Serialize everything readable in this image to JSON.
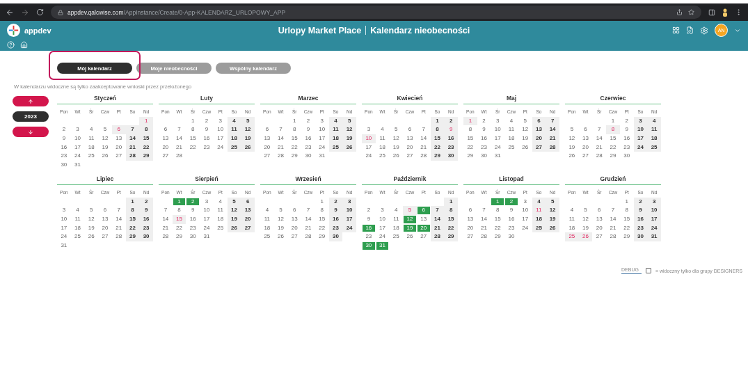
{
  "browser": {
    "url_host": "appdev.qalcwise.com",
    "url_path": "/AppInstance/Create/0-App-KALENDARZ_URLOPOWY_APP"
  },
  "header": {
    "app_name": "appdev",
    "title": "Urlopy Market Place",
    "subtitle": "Kalendarz nieobecności",
    "avatar": "AN"
  },
  "tabs": [
    {
      "label": "Mój kalendarz",
      "selected": true
    },
    {
      "label": "Moje nieobecności",
      "selected": false
    },
    {
      "label": "Wspólny kalendarz",
      "selected": false
    }
  ],
  "notice": "W kalendarzu widoczne są tylko zaakceptowane wnioski przez przełożonego",
  "year": "2023",
  "months": [
    {
      "name": "Styczeń",
      "weekdays": [
        "Pon",
        "Wt",
        "Śr",
        "Czw",
        "Pt",
        "So",
        "Nd"
      ],
      "weeks": [
        [
          {
            "kind": "blank"
          },
          {
            "kind": "blank"
          },
          {
            "kind": "blank"
          },
          {
            "kind": "blank"
          },
          {
            "kind": "blank"
          },
          {
            "kind": "blank"
          },
          {
            "day": "1",
            "kind": "holiday"
          }
        ],
        [
          {
            "day": "2",
            "kind": "workday"
          },
          {
            "day": "3",
            "kind": "workday"
          },
          {
            "day": "4",
            "kind": "workday"
          },
          {
            "day": "5",
            "kind": "workday"
          },
          {
            "day": "6",
            "kind": "holiday"
          },
          {
            "day": "7",
            "kind": "weekend"
          },
          {
            "day": "8",
            "kind": "weekend"
          }
        ],
        [
          {
            "day": "9",
            "kind": "workday"
          },
          {
            "day": "10",
            "kind": "workday"
          },
          {
            "day": "11",
            "kind": "workday"
          },
          {
            "day": "12",
            "kind": "workday"
          },
          {
            "day": "13",
            "kind": "workday"
          },
          {
            "day": "14",
            "kind": "weekend"
          },
          {
            "day": "15",
            "kind": "weekend"
          }
        ],
        [
          {
            "day": "16",
            "kind": "workday"
          },
          {
            "day": "17",
            "kind": "workday"
          },
          {
            "day": "18",
            "kind": "workday"
          },
          {
            "day": "19",
            "kind": "workday"
          },
          {
            "day": "20",
            "kind": "workday"
          },
          {
            "day": "21",
            "kind": "weekend"
          },
          {
            "day": "22",
            "kind": "weekend"
          }
        ],
        [
          {
            "day": "23",
            "kind": "workday"
          },
          {
            "day": "24",
            "kind": "workday"
          },
          {
            "day": "25",
            "kind": "workday"
          },
          {
            "day": "26",
            "kind": "workday"
          },
          {
            "day": "27",
            "kind": "workday"
          },
          {
            "day": "28",
            "kind": "weekend"
          },
          {
            "day": "29",
            "kind": "weekend"
          }
        ],
        [
          {
            "day": "30",
            "kind": "workday"
          },
          {
            "day": "31",
            "kind": "workday"
          }
        ]
      ]
    },
    {
      "name": "Luty",
      "weekdays": [
        "Pon",
        "Wt",
        "Śr",
        "Czw",
        "Pt",
        "So",
        "Nd"
      ],
      "weeks": [
        [
          {
            "kind": "blank"
          },
          {
            "kind": "blank"
          },
          {
            "day": "1",
            "kind": "workday"
          },
          {
            "day": "2",
            "kind": "workday"
          },
          {
            "day": "3",
            "kind": "workday"
          },
          {
            "day": "4",
            "kind": "weekend"
          },
          {
            "day": "5",
            "kind": "weekend"
          }
        ],
        [
          {
            "day": "6",
            "kind": "workday"
          },
          {
            "day": "7",
            "kind": "workday"
          },
          {
            "day": "8",
            "kind": "workday"
          },
          {
            "day": "9",
            "kind": "workday"
          },
          {
            "day": "10",
            "kind": "workday"
          },
          {
            "day": "11",
            "kind": "weekend"
          },
          {
            "day": "12",
            "kind": "weekend"
          }
        ],
        [
          {
            "day": "13",
            "kind": "workday"
          },
          {
            "day": "14",
            "kind": "workday"
          },
          {
            "day": "15",
            "kind": "workday"
          },
          {
            "day": "16",
            "kind": "workday"
          },
          {
            "day": "17",
            "kind": "workday"
          },
          {
            "day": "18",
            "kind": "weekend"
          },
          {
            "day": "19",
            "kind": "weekend"
          }
        ],
        [
          {
            "day": "20",
            "kind": "workday"
          },
          {
            "day": "21",
            "kind": "workday"
          },
          {
            "day": "22",
            "kind": "workday"
          },
          {
            "day": "23",
            "kind": "workday"
          },
          {
            "day": "24",
            "kind": "workday"
          },
          {
            "day": "25",
            "kind": "weekend"
          },
          {
            "day": "26",
            "kind": "weekend"
          }
        ],
        [
          {
            "day": "27",
            "kind": "workday"
          },
          {
            "day": "28",
            "kind": "workday"
          }
        ]
      ]
    },
    {
      "name": "Marzec",
      "weekdays": [
        "Pon",
        "Wt",
        "Śr",
        "Czw",
        "Pt",
        "So",
        "Nd"
      ],
      "weeks": [
        [
          {
            "kind": "blank"
          },
          {
            "kind": "blank"
          },
          {
            "day": "1",
            "kind": "workday"
          },
          {
            "day": "2",
            "kind": "workday"
          },
          {
            "day": "3",
            "kind": "workday"
          },
          {
            "day": "4",
            "kind": "weekend"
          },
          {
            "day": "5",
            "kind": "weekend"
          }
        ],
        [
          {
            "day": "6",
            "kind": "workday"
          },
          {
            "day": "7",
            "kind": "workday"
          },
          {
            "day": "8",
            "kind": "workday"
          },
          {
            "day": "9",
            "kind": "workday"
          },
          {
            "day": "10",
            "kind": "workday"
          },
          {
            "day": "11",
            "kind": "weekend"
          },
          {
            "day": "12",
            "kind": "weekend"
          }
        ],
        [
          {
            "day": "13",
            "kind": "workday"
          },
          {
            "day": "14",
            "kind": "workday"
          },
          {
            "day": "15",
            "kind": "workday"
          },
          {
            "day": "16",
            "kind": "workday"
          },
          {
            "day": "17",
            "kind": "workday"
          },
          {
            "day": "18",
            "kind": "weekend"
          },
          {
            "day": "19",
            "kind": "weekend"
          }
        ],
        [
          {
            "day": "20",
            "kind": "workday"
          },
          {
            "day": "21",
            "kind": "workday"
          },
          {
            "day": "22",
            "kind": "workday"
          },
          {
            "day": "23",
            "kind": "workday"
          },
          {
            "day": "24",
            "kind": "workday"
          },
          {
            "day": "25",
            "kind": "weekend"
          },
          {
            "day": "26",
            "kind": "weekend"
          }
        ],
        [
          {
            "day": "27",
            "kind": "workday"
          },
          {
            "day": "28",
            "kind": "workday"
          },
          {
            "day": "29",
            "kind": "workday"
          },
          {
            "day": "30",
            "kind": "workday"
          },
          {
            "day": "31",
            "kind": "workday"
          }
        ]
      ]
    },
    {
      "name": "Kwiecień",
      "weekdays": [
        "Pon",
        "Wt",
        "Śr",
        "Czw",
        "Pt",
        "So",
        "Nd"
      ],
      "weeks": [
        [
          {
            "kind": "blank"
          },
          {
            "kind": "blank"
          },
          {
            "kind": "blank"
          },
          {
            "kind": "blank"
          },
          {
            "kind": "blank"
          },
          {
            "day": "1",
            "kind": "weekend"
          },
          {
            "day": "2",
            "kind": "weekend"
          }
        ],
        [
          {
            "day": "3",
            "kind": "workday"
          },
          {
            "day": "4",
            "kind": "workday"
          },
          {
            "day": "5",
            "kind": "workday"
          },
          {
            "day": "6",
            "kind": "workday"
          },
          {
            "day": "7",
            "kind": "workday"
          },
          {
            "day": "8",
            "kind": "weekend"
          },
          {
            "day": "9",
            "kind": "holiday"
          }
        ],
        [
          {
            "day": "10",
            "kind": "holiday"
          },
          {
            "day": "11",
            "kind": "workday"
          },
          {
            "day": "12",
            "kind": "workday"
          },
          {
            "day": "13",
            "kind": "workday"
          },
          {
            "day": "14",
            "kind": "workday"
          },
          {
            "day": "15",
            "kind": "weekend"
          },
          {
            "day": "16",
            "kind": "weekend"
          }
        ],
        [
          {
            "day": "17",
            "kind": "workday"
          },
          {
            "day": "18",
            "kind": "workday"
          },
          {
            "day": "19",
            "kind": "workday"
          },
          {
            "day": "20",
            "kind": "workday"
          },
          {
            "day": "21",
            "kind": "workday"
          },
          {
            "day": "22",
            "kind": "weekend"
          },
          {
            "day": "23",
            "kind": "weekend"
          }
        ],
        [
          {
            "day": "24",
            "kind": "workday"
          },
          {
            "day": "25",
            "kind": "workday"
          },
          {
            "day": "26",
            "kind": "workday"
          },
          {
            "day": "27",
            "kind": "workday"
          },
          {
            "day": "28",
            "kind": "workday"
          },
          {
            "day": "29",
            "kind": "weekend"
          },
          {
            "day": "30",
            "kind": "weekend"
          }
        ]
      ]
    },
    {
      "name": "Maj",
      "weekdays": [
        "Pon",
        "Wt",
        "Śr",
        "Czw",
        "Pt",
        "So",
        "Nd"
      ],
      "weeks": [
        [
          {
            "day": "1",
            "kind": "holiday"
          },
          {
            "day": "2",
            "kind": "workday"
          },
          {
            "day": "3",
            "kind": "workday"
          },
          {
            "day": "4",
            "kind": "workday"
          },
          {
            "day": "5",
            "kind": "workday"
          },
          {
            "day": "6",
            "kind": "weekend"
          },
          {
            "day": "7",
            "kind": "weekend"
          }
        ],
        [
          {
            "day": "8",
            "kind": "workday"
          },
          {
            "day": "9",
            "kind": "workday"
          },
          {
            "day": "10",
            "kind": "workday"
          },
          {
            "day": "11",
            "kind": "workday"
          },
          {
            "day": "12",
            "kind": "workday"
          },
          {
            "day": "13",
            "kind": "weekend"
          },
          {
            "day": "14",
            "kind": "weekend"
          }
        ],
        [
          {
            "day": "15",
            "kind": "workday"
          },
          {
            "day": "16",
            "kind": "workday"
          },
          {
            "day": "17",
            "kind": "workday"
          },
          {
            "day": "18",
            "kind": "workday"
          },
          {
            "day": "19",
            "kind": "workday"
          },
          {
            "day": "20",
            "kind": "weekend"
          },
          {
            "day": "21",
            "kind": "weekend"
          }
        ],
        [
          {
            "day": "22",
            "kind": "workday"
          },
          {
            "day": "23",
            "kind": "workday"
          },
          {
            "day": "24",
            "kind": "workday"
          },
          {
            "day": "25",
            "kind": "workday"
          },
          {
            "day": "26",
            "kind": "workday"
          },
          {
            "day": "27",
            "kind": "weekend"
          },
          {
            "day": "28",
            "kind": "weekend"
          }
        ],
        [
          {
            "day": "29",
            "kind": "workday"
          },
          {
            "day": "30",
            "kind": "workday"
          },
          {
            "day": "31",
            "kind": "workday"
          }
        ]
      ]
    },
    {
      "name": "Czerwiec",
      "weekdays": [
        "Pon",
        "Wt",
        "Śr",
        "Czw",
        "Pt",
        "So",
        "Nd"
      ],
      "weeks": [
        [
          {
            "kind": "blank"
          },
          {
            "kind": "blank"
          },
          {
            "kind": "blank"
          },
          {
            "day": "1",
            "kind": "workday"
          },
          {
            "day": "2",
            "kind": "workday"
          },
          {
            "day": "3",
            "kind": "weekend"
          },
          {
            "day": "4",
            "kind": "weekend"
          }
        ],
        [
          {
            "day": "5",
            "kind": "workday"
          },
          {
            "day": "6",
            "kind": "workday"
          },
          {
            "day": "7",
            "kind": "workday"
          },
          {
            "day": "8",
            "kind": "holiday"
          },
          {
            "day": "9",
            "kind": "workday"
          },
          {
            "day": "10",
            "kind": "weekend"
          },
          {
            "day": "11",
            "kind": "weekend"
          }
        ],
        [
          {
            "day": "12",
            "kind": "workday"
          },
          {
            "day": "13",
            "kind": "workday"
          },
          {
            "day": "14",
            "kind": "workday"
          },
          {
            "day": "15",
            "kind": "workday"
          },
          {
            "day": "16",
            "kind": "workday"
          },
          {
            "day": "17",
            "kind": "weekend"
          },
          {
            "day": "18",
            "kind": "weekend"
          }
        ],
        [
          {
            "day": "19",
            "kind": "workday"
          },
          {
            "day": "20",
            "kind": "workday"
          },
          {
            "day": "21",
            "kind": "workday"
          },
          {
            "day": "22",
            "kind": "workday"
          },
          {
            "day": "23",
            "kind": "workday"
          },
          {
            "day": "24",
            "kind": "weekend"
          },
          {
            "day": "25",
            "kind": "weekend"
          }
        ],
        [
          {
            "day": "26",
            "kind": "workday"
          },
          {
            "day": "27",
            "kind": "workday"
          },
          {
            "day": "28",
            "kind": "workday"
          },
          {
            "day": "29",
            "kind": "workday"
          },
          {
            "day": "30",
            "kind": "workday"
          }
        ]
      ]
    },
    {
      "name": "Lipiec",
      "weekdays": [
        "Pon",
        "Wt",
        "Śr",
        "Czw",
        "Pt",
        "So",
        "Nd"
      ],
      "weeks": [
        [
          {
            "kind": "blank"
          },
          {
            "kind": "blank"
          },
          {
            "kind": "blank"
          },
          {
            "kind": "blank"
          },
          {
            "kind": "blank"
          },
          {
            "day": "1",
            "kind": "weekend"
          },
          {
            "day": "2",
            "kind": "weekend"
          }
        ],
        [
          {
            "day": "3",
            "kind": "workday"
          },
          {
            "day": "4",
            "kind": "workday"
          },
          {
            "day": "5",
            "kind": "workday"
          },
          {
            "day": "6",
            "kind": "workday"
          },
          {
            "day": "7",
            "kind": "workday"
          },
          {
            "day": "8",
            "kind": "weekend"
          },
          {
            "day": "9",
            "kind": "weekend"
          }
        ],
        [
          {
            "day": "10",
            "kind": "workday"
          },
          {
            "day": "11",
            "kind": "workday"
          },
          {
            "day": "12",
            "kind": "workday"
          },
          {
            "day": "13",
            "kind": "workday"
          },
          {
            "day": "14",
            "kind": "workday"
          },
          {
            "day": "15",
            "kind": "weekend"
          },
          {
            "day": "16",
            "kind": "weekend"
          }
        ],
        [
          {
            "day": "17",
            "kind": "workday"
          },
          {
            "day": "18",
            "kind": "workday"
          },
          {
            "day": "19",
            "kind": "workday"
          },
          {
            "day": "20",
            "kind": "workday"
          },
          {
            "day": "21",
            "kind": "workday"
          },
          {
            "day": "22",
            "kind": "weekend"
          },
          {
            "day": "23",
            "kind": "weekend"
          }
        ],
        [
          {
            "day": "24",
            "kind": "workday"
          },
          {
            "day": "25",
            "kind": "workday"
          },
          {
            "day": "26",
            "kind": "workday"
          },
          {
            "day": "27",
            "kind": "workday"
          },
          {
            "day": "28",
            "kind": "workday"
          },
          {
            "day": "29",
            "kind": "weekend"
          },
          {
            "day": "30",
            "kind": "weekend"
          }
        ],
        [
          {
            "day": "31",
            "kind": "workday"
          }
        ]
      ]
    },
    {
      "name": "Sierpień",
      "weekdays": [
        "Pon",
        "Wt",
        "Śr",
        "Czw",
        "Pt",
        "So",
        "Nd"
      ],
      "weeks": [
        [
          {
            "kind": "blank"
          },
          {
            "day": "1",
            "kind": "leave"
          },
          {
            "day": "2",
            "kind": "leave"
          },
          {
            "day": "3",
            "kind": "workday"
          },
          {
            "day": "4",
            "kind": "workday"
          },
          {
            "day": "5",
            "kind": "weekend"
          },
          {
            "day": "6",
            "kind": "weekend"
          }
        ],
        [
          {
            "day": "7",
            "kind": "workday"
          },
          {
            "day": "8",
            "kind": "workday"
          },
          {
            "day": "9",
            "kind": "workday"
          },
          {
            "day": "10",
            "kind": "workday"
          },
          {
            "day": "11",
            "kind": "workday"
          },
          {
            "day": "12",
            "kind": "weekend"
          },
          {
            "day": "13",
            "kind": "weekend"
          }
        ],
        [
          {
            "day": "14",
            "kind": "workday"
          },
          {
            "day": "15",
            "kind": "holiday"
          },
          {
            "day": "16",
            "kind": "workday"
          },
          {
            "day": "17",
            "kind": "workday"
          },
          {
            "day": "18",
            "kind": "workday"
          },
          {
            "day": "19",
            "kind": "weekend"
          },
          {
            "day": "20",
            "kind": "weekend"
          }
        ],
        [
          {
            "day": "21",
            "kind": "workday"
          },
          {
            "day": "22",
            "kind": "workday"
          },
          {
            "day": "23",
            "kind": "workday"
          },
          {
            "day": "24",
            "kind": "workday"
          },
          {
            "day": "25",
            "kind": "workday"
          },
          {
            "day": "26",
            "kind": "weekend"
          },
          {
            "day": "27",
            "kind": "weekend"
          }
        ],
        [
          {
            "day": "28",
            "kind": "workday"
          },
          {
            "day": "29",
            "kind": "workday"
          },
          {
            "day": "30",
            "kind": "workday"
          },
          {
            "day": "31",
            "kind": "workday"
          }
        ]
      ]
    },
    {
      "name": "Wrzesień",
      "weekdays": [
        "Pon",
        "Wt",
        "Śr",
        "Czw",
        "Pt",
        "So",
        "Nd"
      ],
      "weeks": [
        [
          {
            "kind": "blank"
          },
          {
            "kind": "blank"
          },
          {
            "kind": "blank"
          },
          {
            "kind": "blank"
          },
          {
            "day": "1",
            "kind": "workday"
          },
          {
            "day": "2",
            "kind": "weekend"
          },
          {
            "day": "3",
            "kind": "weekend"
          }
        ],
        [
          {
            "day": "4",
            "kind": "workday"
          },
          {
            "day": "5",
            "kind": "workday"
          },
          {
            "day": "6",
            "kind": "workday"
          },
          {
            "day": "7",
            "kind": "workday"
          },
          {
            "day": "8",
            "kind": "workday"
          },
          {
            "day": "9",
            "kind": "weekend"
          },
          {
            "day": "10",
            "kind": "weekend"
          }
        ],
        [
          {
            "day": "11",
            "kind": "workday"
          },
          {
            "day": "12",
            "kind": "workday"
          },
          {
            "day": "13",
            "kind": "workday"
          },
          {
            "day": "14",
            "kind": "workday"
          },
          {
            "day": "15",
            "kind": "workday"
          },
          {
            "day": "16",
            "kind": "weekend"
          },
          {
            "day": "17",
            "kind": "weekend"
          }
        ],
        [
          {
            "day": "18",
            "kind": "workday"
          },
          {
            "day": "19",
            "kind": "workday"
          },
          {
            "day": "20",
            "kind": "workday"
          },
          {
            "day": "21",
            "kind": "workday"
          },
          {
            "day": "22",
            "kind": "workday"
          },
          {
            "day": "23",
            "kind": "weekend"
          },
          {
            "day": "24",
            "kind": "weekend"
          }
        ],
        [
          {
            "day": "25",
            "kind": "workday"
          },
          {
            "day": "26",
            "kind": "workday"
          },
          {
            "day": "27",
            "kind": "workday"
          },
          {
            "day": "28",
            "kind": "workday"
          },
          {
            "day": "29",
            "kind": "workday"
          },
          {
            "day": "30",
            "kind": "weekend"
          }
        ]
      ]
    },
    {
      "name": "Październik",
      "weekdays": [
        "Pon",
        "Wt",
        "Śr",
        "Czw",
        "Pt",
        "So",
        "Nd"
      ],
      "weeks": [
        [
          {
            "kind": "blank"
          },
          {
            "kind": "blank"
          },
          {
            "kind": "blank"
          },
          {
            "kind": "blank"
          },
          {
            "kind": "blank"
          },
          {
            "kind": "blank"
          },
          {
            "day": "1",
            "kind": "weekend"
          }
        ],
        [
          {
            "day": "2",
            "kind": "workday"
          },
          {
            "day": "3",
            "kind": "workday"
          },
          {
            "day": "4",
            "kind": "workday"
          },
          {
            "day": "5",
            "kind": "holiday"
          },
          {
            "day": "6",
            "kind": "leave"
          },
          {
            "day": "7",
            "kind": "weekend"
          },
          {
            "day": "8",
            "kind": "weekend"
          }
        ],
        [
          {
            "day": "9",
            "kind": "workday"
          },
          {
            "day": "10",
            "kind": "workday"
          },
          {
            "day": "11",
            "kind": "workday"
          },
          {
            "day": "12",
            "kind": "leave"
          },
          {
            "day": "13",
            "kind": "workday"
          },
          {
            "day": "14",
            "kind": "weekend"
          },
          {
            "day": "15",
            "kind": "weekend"
          }
        ],
        [
          {
            "day": "16",
            "kind": "leave"
          },
          {
            "day": "17",
            "kind": "workday"
          },
          {
            "day": "18",
            "kind": "workday"
          },
          {
            "day": "19",
            "kind": "leave"
          },
          {
            "day": "20",
            "kind": "leave"
          },
          {
            "day": "21",
            "kind": "weekend"
          },
          {
            "day": "22",
            "kind": "weekend"
          }
        ],
        [
          {
            "day": "23",
            "kind": "workday"
          },
          {
            "day": "24",
            "kind": "workday"
          },
          {
            "day": "25",
            "kind": "workday"
          },
          {
            "day": "26",
            "kind": "workday"
          },
          {
            "day": "27",
            "kind": "workday"
          },
          {
            "day": "28",
            "kind": "weekend"
          },
          {
            "day": "29",
            "kind": "weekend"
          }
        ],
        [
          {
            "day": "30",
            "kind": "leave"
          },
          {
            "day": "31",
            "kind": "leave"
          }
        ]
      ]
    },
    {
      "name": "Listopad",
      "weekdays": [
        "Pon",
        "Wt",
        "Śr",
        "Czw",
        "Pt",
        "So",
        "Nd"
      ],
      "weeks": [
        [
          {
            "kind": "blank"
          },
          {
            "kind": "blank"
          },
          {
            "day": "1",
            "kind": "leave"
          },
          {
            "day": "2",
            "kind": "leave"
          },
          {
            "day": "3",
            "kind": "workday"
          },
          {
            "day": "4",
            "kind": "weekend"
          },
          {
            "day": "5",
            "kind": "weekend"
          }
        ],
        [
          {
            "day": "6",
            "kind": "workday"
          },
          {
            "day": "7",
            "kind": "workday"
          },
          {
            "day": "8",
            "kind": "workday"
          },
          {
            "day": "9",
            "kind": "workday"
          },
          {
            "day": "10",
            "kind": "workday"
          },
          {
            "day": "11",
            "kind": "holiday"
          },
          {
            "day": "12",
            "kind": "weekend"
          }
        ],
        [
          {
            "day": "13",
            "kind": "workday"
          },
          {
            "day": "14",
            "kind": "workday"
          },
          {
            "day": "15",
            "kind": "workday"
          },
          {
            "day": "16",
            "kind": "workday"
          },
          {
            "day": "17",
            "kind": "workday"
          },
          {
            "day": "18",
            "kind": "weekend"
          },
          {
            "day": "19",
            "kind": "weekend"
          }
        ],
        [
          {
            "day": "20",
            "kind": "workday"
          },
          {
            "day": "21",
            "kind": "workday"
          },
          {
            "day": "22",
            "kind": "workday"
          },
          {
            "day": "23",
            "kind": "workday"
          },
          {
            "day": "24",
            "kind": "workday"
          },
          {
            "day": "25",
            "kind": "weekend"
          },
          {
            "day": "26",
            "kind": "weekend"
          }
        ],
        [
          {
            "day": "27",
            "kind": "workday"
          },
          {
            "day": "28",
            "kind": "workday"
          },
          {
            "day": "29",
            "kind": "workday"
          },
          {
            "day": "30",
            "kind": "workday"
          }
        ]
      ]
    },
    {
      "name": "Grudzień",
      "weekdays": [
        "Pon",
        "Wt",
        "Śr",
        "Czw",
        "Pt",
        "So",
        "Nd"
      ],
      "weeks": [
        [
          {
            "kind": "blank"
          },
          {
            "kind": "blank"
          },
          {
            "kind": "blank"
          },
          {
            "kind": "blank"
          },
          {
            "day": "1",
            "kind": "workday"
          },
          {
            "day": "2",
            "kind": "weekend"
          },
          {
            "day": "3",
            "kind": "weekend"
          }
        ],
        [
          {
            "day": "4",
            "kind": "workday"
          },
          {
            "day": "5",
            "kind": "workday"
          },
          {
            "day": "6",
            "kind": "workday"
          },
          {
            "day": "7",
            "kind": "workday"
          },
          {
            "day": "8",
            "kind": "workday"
          },
          {
            "day": "9",
            "kind": "weekend"
          },
          {
            "day": "10",
            "kind": "weekend"
          }
        ],
        [
          {
            "day": "11",
            "kind": "workday"
          },
          {
            "day": "12",
            "kind": "workday"
          },
          {
            "day": "13",
            "kind": "workday"
          },
          {
            "day": "14",
            "kind": "workday"
          },
          {
            "day": "15",
            "kind": "workday"
          },
          {
            "day": "16",
            "kind": "weekend"
          },
          {
            "day": "17",
            "kind": "weekend"
          }
        ],
        [
          {
            "day": "18",
            "kind": "workday"
          },
          {
            "day": "19",
            "kind": "workday"
          },
          {
            "day": "20",
            "kind": "workday"
          },
          {
            "day": "21",
            "kind": "workday"
          },
          {
            "day": "22",
            "kind": "workday"
          },
          {
            "day": "23",
            "kind": "weekend"
          },
          {
            "day": "24",
            "kind": "weekend"
          }
        ],
        [
          {
            "day": "25",
            "kind": "holiday"
          },
          {
            "day": "26",
            "kind": "holiday"
          },
          {
            "day": "27",
            "kind": "workday"
          },
          {
            "day": "28",
            "kind": "workday"
          },
          {
            "day": "29",
            "kind": "workday"
          },
          {
            "day": "30",
            "kind": "weekend"
          },
          {
            "day": "31",
            "kind": "weekend"
          }
        ]
      ]
    }
  ],
  "debug": {
    "label": "DEBUG",
    "checked": false,
    "note": "= widoczny tylko dla grupy DESIGNERS"
  }
}
